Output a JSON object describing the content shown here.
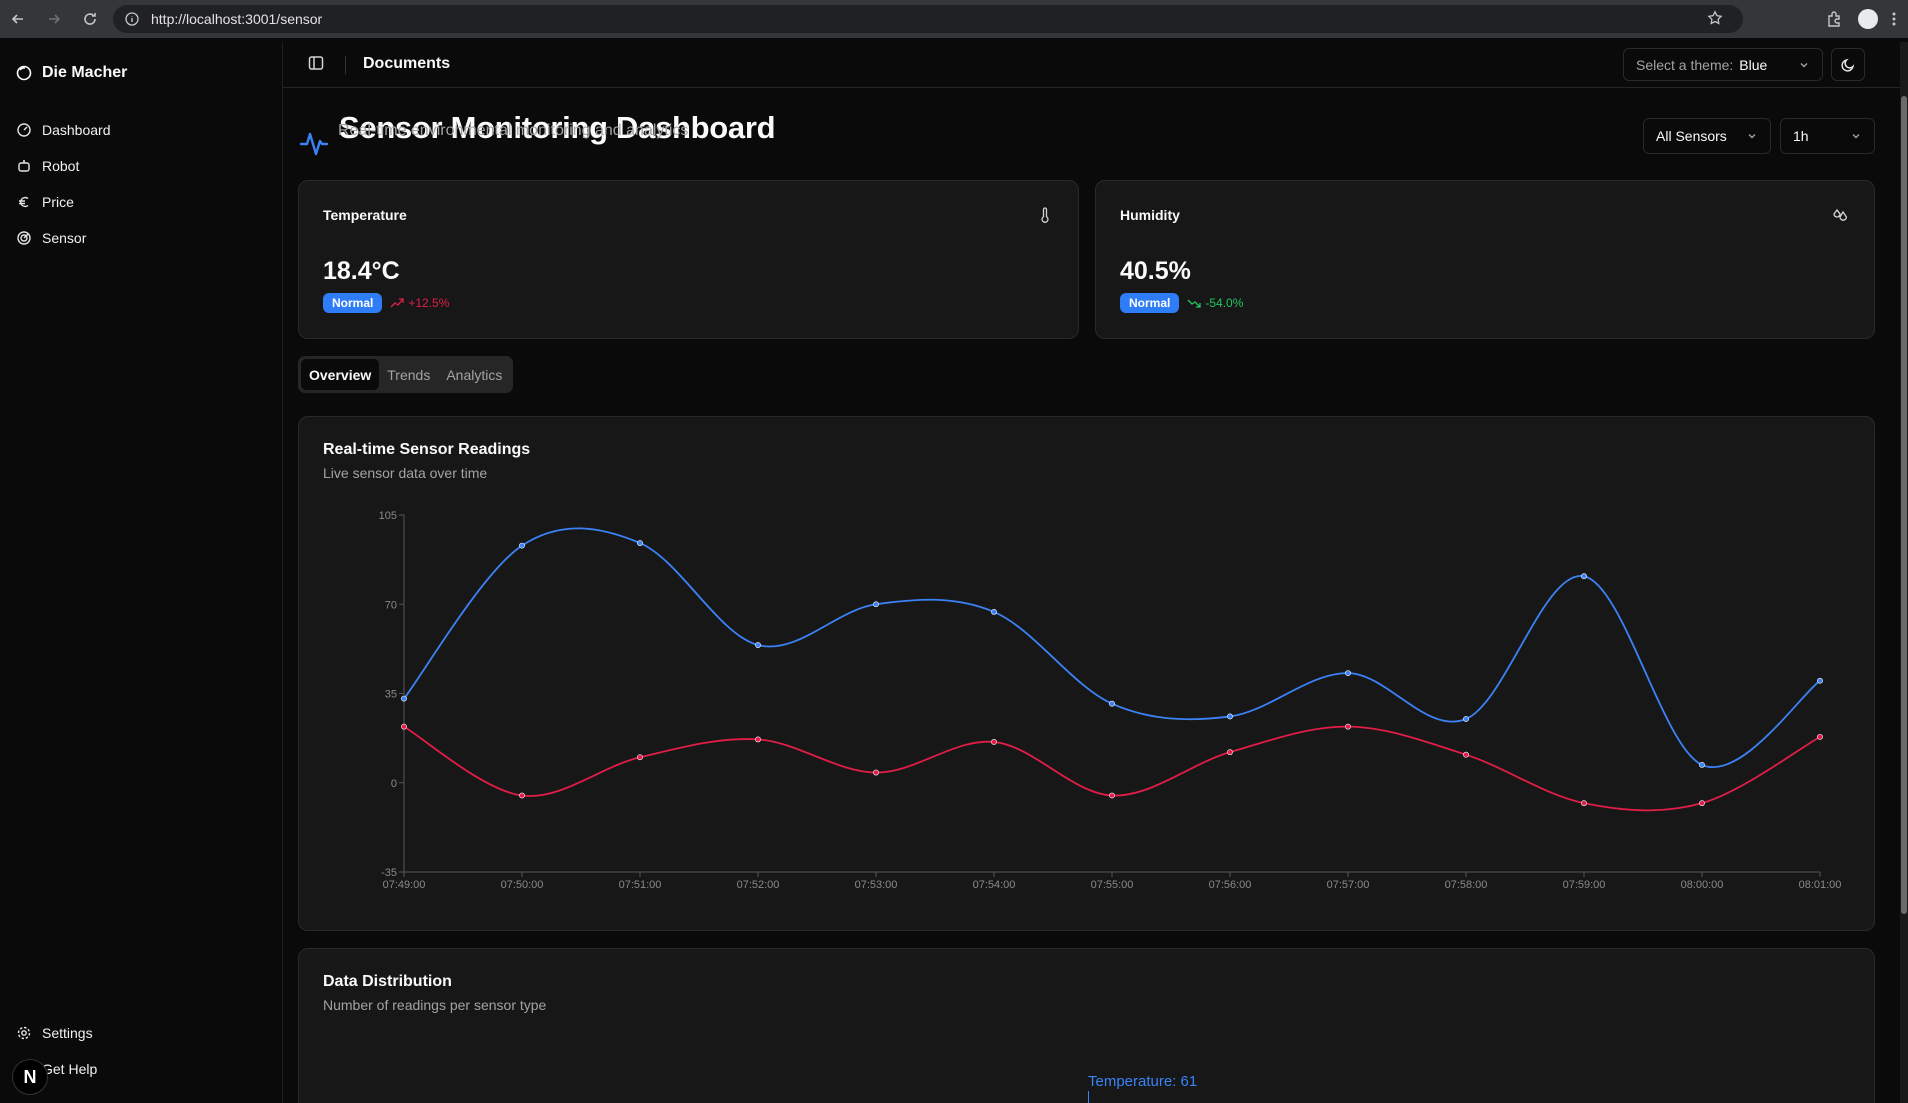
{
  "browser": {
    "url": "http://localhost:3001/sensor"
  },
  "sidebar": {
    "brand": "Die Macher",
    "items": [
      {
        "label": "Dashboard",
        "icon": "gauge-icon"
      },
      {
        "label": "Robot",
        "icon": "bot-icon"
      },
      {
        "label": "Price",
        "icon": "euro-icon"
      },
      {
        "label": "Sensor",
        "icon": "radar-icon"
      }
    ],
    "bottom": [
      {
        "label": "Settings",
        "icon": "gear-icon"
      },
      {
        "label": "Get Help",
        "icon": "help-icon"
      }
    ],
    "badge_letter": "N"
  },
  "topbar": {
    "title": "Documents",
    "theme_label": "Select a theme:",
    "theme_value": "Blue"
  },
  "header": {
    "title": "Sensor Monitoring Dashboard",
    "subtitle": "Real-time environmental monitoring and analytics",
    "sensor_filter": "All Sensors",
    "time_range": "1h"
  },
  "stats": [
    {
      "label": "Temperature",
      "value": "18.4°C",
      "status": "Normal",
      "trend": "+12.5%",
      "trend_color": "#e11d48",
      "icon": "thermometer-icon"
    },
    {
      "label": "Humidity",
      "value": "40.5%",
      "status": "Normal",
      "trend": "-54.0%",
      "trend_color": "#22c55e",
      "icon": "droplets-icon"
    }
  ],
  "tabs": [
    "Overview",
    "Trends",
    "Analytics"
  ],
  "active_tab": "Overview",
  "realtime": {
    "title": "Real-time Sensor Readings",
    "subtitle": "Live sensor data over time"
  },
  "distribution": {
    "title": "Data Distribution",
    "subtitle": "Number of readings per sensor type",
    "label": "Temperature: 61"
  },
  "colors": {
    "accent": "#2f7df6",
    "temperature": "#e11d48",
    "humidity": "#3b82f6"
  },
  "chart_data": {
    "type": "line",
    "x": [
      "07:49:00",
      "07:50:00",
      "07:51:00",
      "07:52:00",
      "07:53:00",
      "07:54:00",
      "07:55:00",
      "07:56:00",
      "07:57:00",
      "07:58:00",
      "07:59:00",
      "08:00:00",
      "08:01:00"
    ],
    "ylim": [
      -35,
      105
    ],
    "yticks": [
      -35,
      0,
      35,
      70,
      105
    ],
    "series": [
      {
        "color": "#3b82f6",
        "values": [
          33,
          93,
          94,
          54,
          70,
          67,
          31,
          26,
          43,
          25,
          81,
          7,
          40
        ]
      },
      {
        "color": "#e11d48",
        "values": [
          22,
          -5,
          10,
          17,
          4,
          16,
          -5,
          12,
          22,
          11,
          -8,
          -8,
          18
        ]
      }
    ],
    "grid": false
  }
}
